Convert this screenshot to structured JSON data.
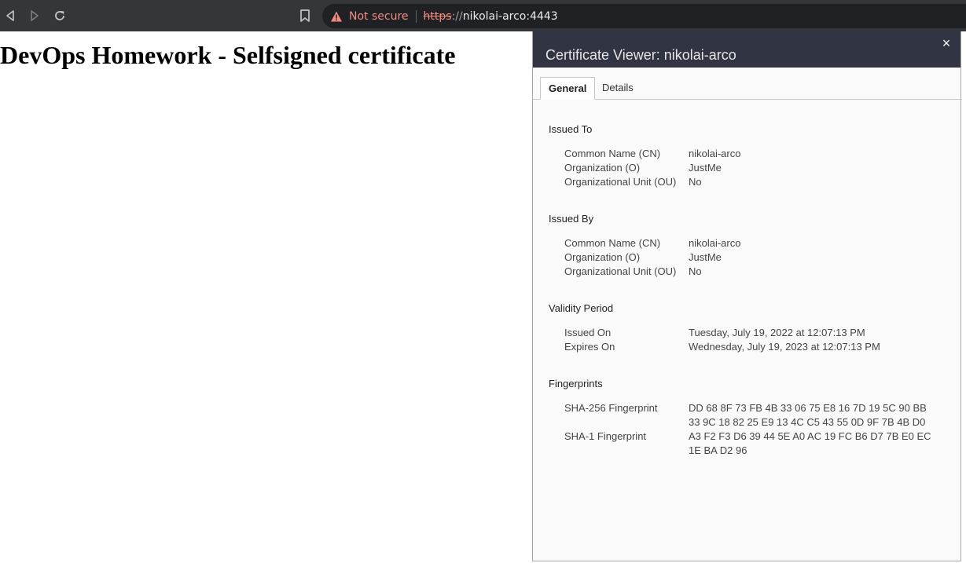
{
  "browser": {
    "security_label": "Not secure",
    "url_scheme": "https",
    "url_rest": "://",
    "url_host": "nikolai-arco:4443"
  },
  "page": {
    "heading": "DevOps Homework - Selfsigned certificate"
  },
  "dialog": {
    "title": "Certificate Viewer: nikolai-arco",
    "close_label": "×",
    "tabs": [
      {
        "label": "General",
        "active": true
      },
      {
        "label": "Details",
        "active": false
      }
    ],
    "issued_to": {
      "title": "Issued To",
      "rows": [
        {
          "label": "Common Name (CN)",
          "value": "nikolai-arco"
        },
        {
          "label": "Organization (O)",
          "value": "JustMe"
        },
        {
          "label": "Organizational Unit (OU)",
          "value": "No"
        }
      ]
    },
    "issued_by": {
      "title": "Issued By",
      "rows": [
        {
          "label": "Common Name (CN)",
          "value": "nikolai-arco"
        },
        {
          "label": "Organization (O)",
          "value": "JustMe"
        },
        {
          "label": "Organizational Unit (OU)",
          "value": "No"
        }
      ]
    },
    "validity": {
      "title": "Validity Period",
      "rows": [
        {
          "label": "Issued On",
          "value": "Tuesday, July 19, 2022 at 12:07:13 PM"
        },
        {
          "label": "Expires On",
          "value": "Wednesday, July 19, 2023 at 12:07:13 PM"
        }
      ]
    },
    "fingerprints": {
      "title": "Fingerprints",
      "sha256_label": "SHA-256 Fingerprint",
      "sha256_line1": "DD 68 8F 73 FB 4B 33 06 75 E8 16 7D 19 5C 90 BB",
      "sha256_line2": "33 9C 18 82 25 E9 13 4C C5 43 55 0D 9F 7B 4B D0",
      "sha1_label": "SHA-1 Fingerprint",
      "sha1_line1": "A3 F2 F3 D6 39 44 5E A0 AC 19 FC B6 D7 7B E0 EC",
      "sha1_line2": "1E BA D2 96"
    }
  },
  "icons": {
    "back": "back-icon",
    "forward": "forward-icon",
    "reload": "reload-icon",
    "bookmark": "bookmark-icon",
    "warning": "warning-icon"
  },
  "colors": {
    "toolbar_bg": "#35363a",
    "omnibox_bg": "#202124",
    "warning": "#f28b82",
    "dialog_header": "#303443"
  }
}
